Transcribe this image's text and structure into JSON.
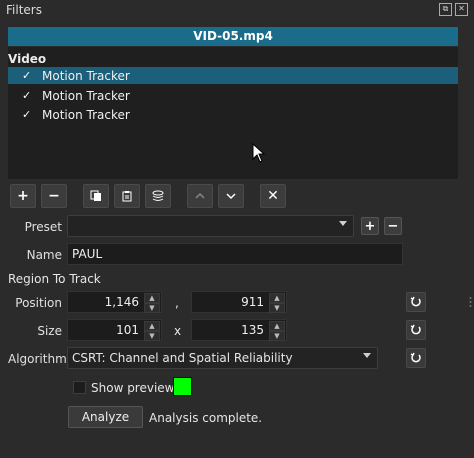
{
  "panel": {
    "title": "Filters"
  },
  "file": {
    "name": "VID-05.mp4"
  },
  "list": {
    "header": "Video",
    "items": [
      {
        "checked": "✓",
        "label": "Motion Tracker",
        "selected": true
      },
      {
        "checked": "✓",
        "label": "Motion Tracker",
        "selected": false
      },
      {
        "checked": "✓",
        "label": "Motion Tracker",
        "selected": false
      }
    ]
  },
  "toolbar": {
    "add": "+",
    "remove": "−",
    "copy": "copy-icon",
    "paste": "paste-icon",
    "save": "stack-icon",
    "up": "up-icon",
    "down": "down-icon",
    "close": "✕"
  },
  "preset": {
    "label": "Preset",
    "value": "",
    "add": "+",
    "remove": "−"
  },
  "name": {
    "label": "Name",
    "value": "PAUL"
  },
  "region": {
    "label": "Region To Track"
  },
  "position": {
    "label": "Position",
    "x": "1,146",
    "sep": ",",
    "y": "911"
  },
  "size": {
    "label": "Size",
    "w": "101",
    "sep": "x",
    "h": "135"
  },
  "algorithm": {
    "label": "Algorithm",
    "value": "CSRT: Channel and Spatial Reliability"
  },
  "preview": {
    "label": "Show preview",
    "color": "#00ff00"
  },
  "analyze": {
    "button": "Analyze",
    "status": "Analysis complete."
  },
  "colors": {
    "accent": "#1b6b8a",
    "selection": "#1b5f7a",
    "background": "#2b2b2b"
  }
}
